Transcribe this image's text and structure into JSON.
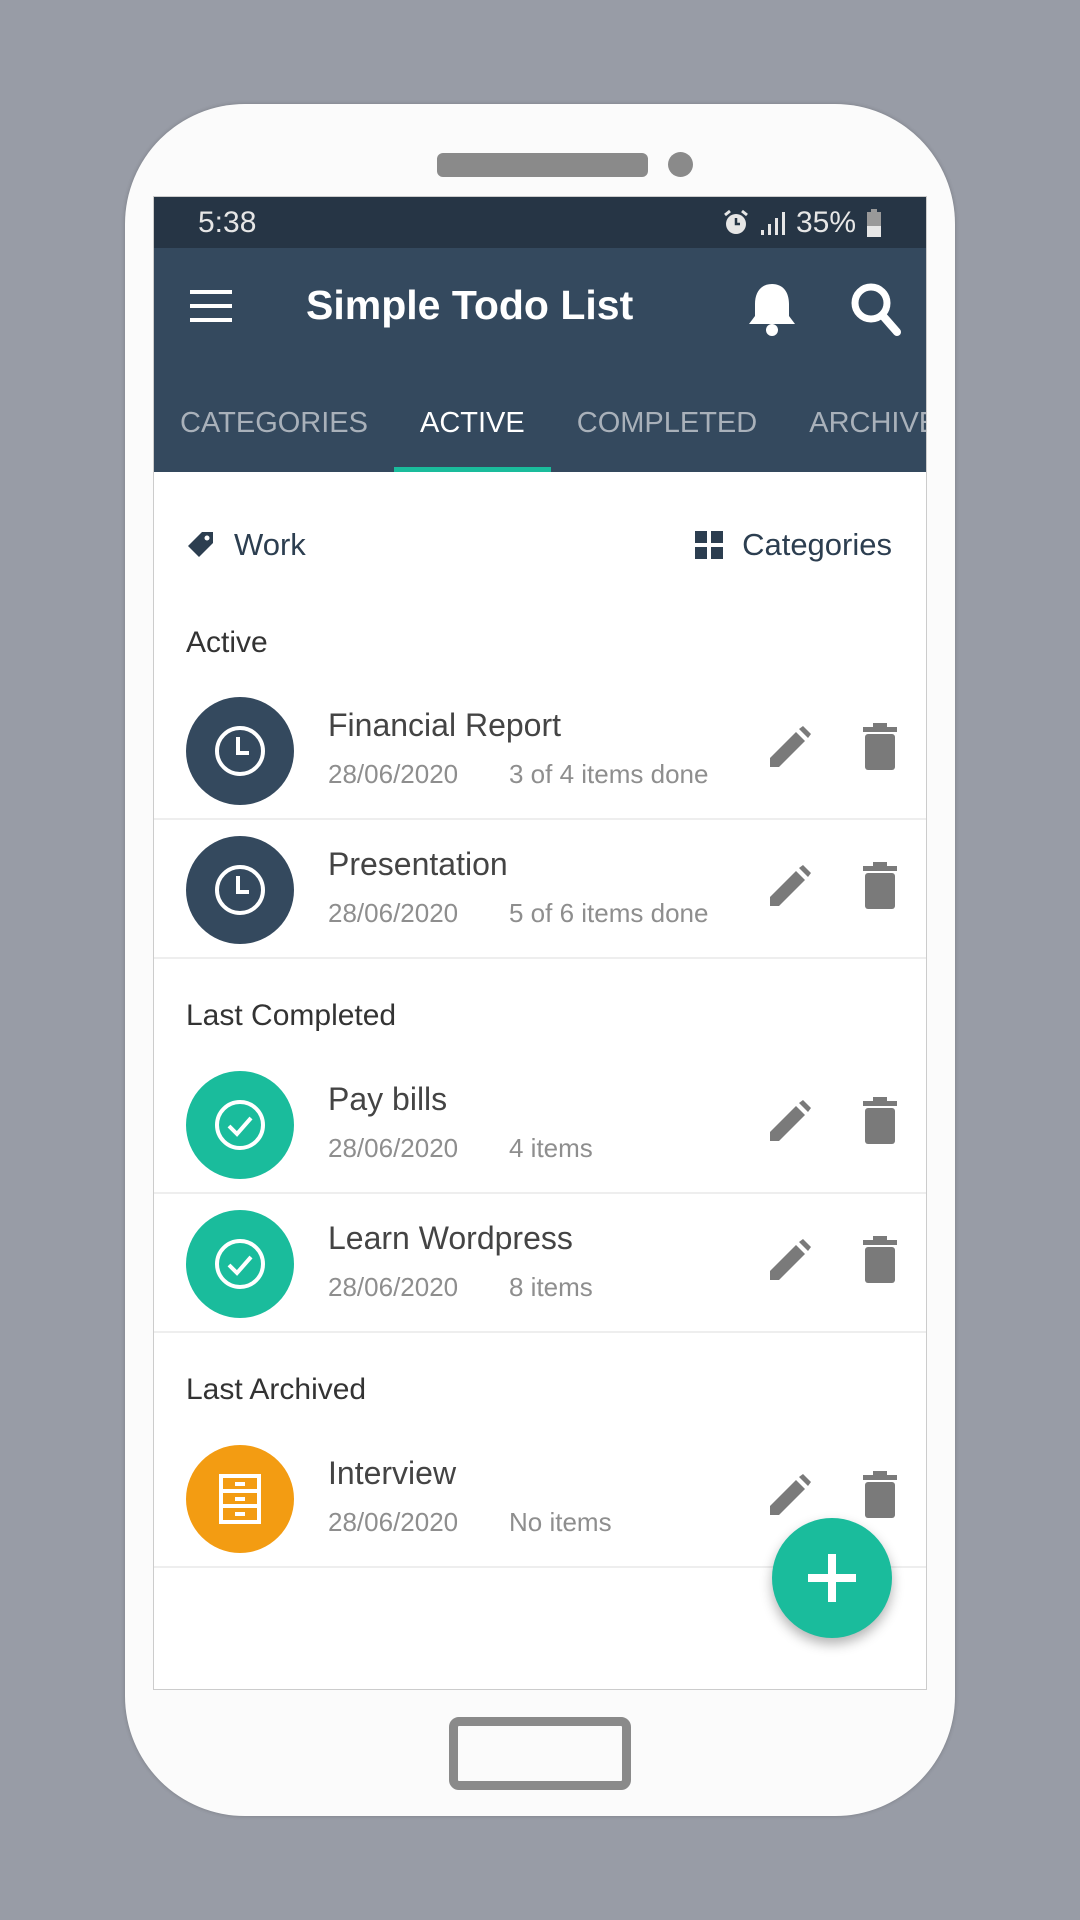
{
  "status": {
    "time": "5:38",
    "battery": "35%"
  },
  "toolbar": {
    "title": "Simple Todo List"
  },
  "tabs": [
    {
      "label": "CATEGORIES"
    },
    {
      "label": "ACTIVE",
      "active": true
    },
    {
      "label": "COMPLETED"
    },
    {
      "label": "ARCHIVED"
    }
  ],
  "filter": {
    "category": "Work",
    "categories_button": "Categories"
  },
  "sections": {
    "active": "Active",
    "completed": "Last Completed",
    "archived": "Last Archived"
  },
  "rows": [
    {
      "title": "Financial Report",
      "date": "28/06/2020",
      "info": "3 of 4 items done",
      "status": "active",
      "icon": "clock-icon"
    },
    {
      "title": "Presentation",
      "date": "28/06/2020",
      "info": "5 of 6 items done",
      "status": "active",
      "icon": "clock-icon"
    },
    {
      "title": "Pay bills",
      "date": "28/06/2020",
      "info": "4 items",
      "status": "completed",
      "icon": "check-icon"
    },
    {
      "title": "Learn Wordpress",
      "date": "28/06/2020",
      "info": "8 items",
      "status": "completed",
      "icon": "check-icon"
    },
    {
      "title": "Interview",
      "date": "28/06/2020",
      "info": "No items",
      "status": "archived",
      "icon": "archive-icon"
    }
  ],
  "colors": {
    "active": "#34495e",
    "completed": "#1abc9c",
    "archived": "#f39c12",
    "accent": "#1abc9c"
  }
}
